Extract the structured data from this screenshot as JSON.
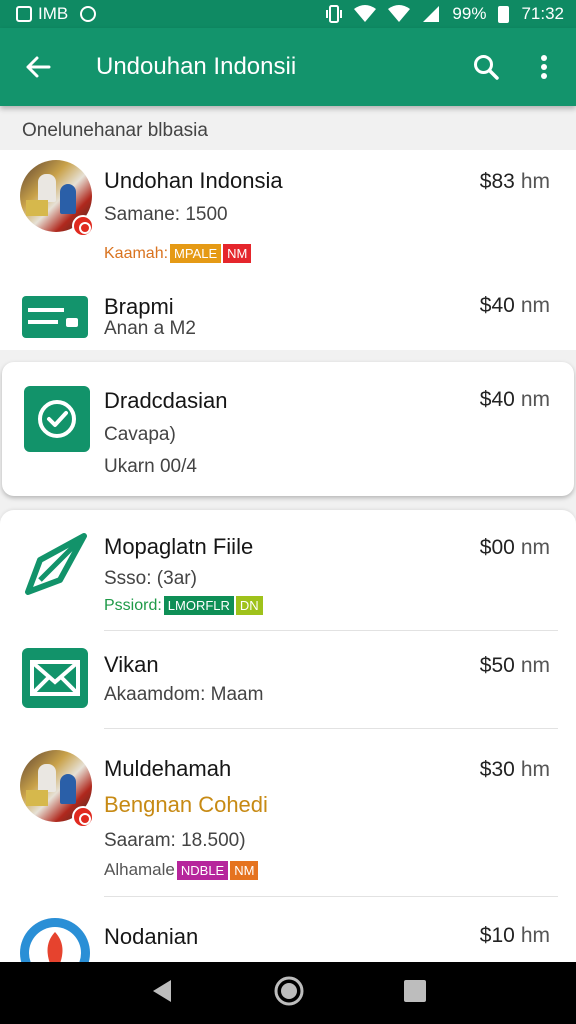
{
  "status_bar": {
    "left_text": "IMB",
    "battery": "99%",
    "time": "71:32"
  },
  "app_bar": {
    "title": "Undouhan Indonsii"
  },
  "section_header": "Onelunehanar blbasia",
  "items": [
    {
      "title": "Undohan Indonsia",
      "subtitle": "Samane: 1500",
      "price": "$83",
      "unit": "hm",
      "tag_label": "Kaamah:",
      "tags": [
        {
          "text": "MPALE",
          "color": "#e59a15"
        },
        {
          "text": "NM",
          "color": "#e5262c"
        }
      ]
    },
    {
      "title": "Brapmi",
      "subtitle": "Anan a M2",
      "price": "$40",
      "unit": "nm"
    },
    {
      "title": "Dradcdasian",
      "subtitle": "Cavapa)",
      "extra": "Ukarn 00/4",
      "price": "$40",
      "unit": "nm"
    },
    {
      "title": "Mopaglatn Fiile",
      "subtitle": "Ssso: (3ar)",
      "price": "$00",
      "unit": "nm",
      "tag_label": "Pssiord:",
      "tags": [
        {
          "text": "LMORFLR",
          "color": "#0e8f56"
        },
        {
          "text": "DN",
          "color": "#9fc21b"
        }
      ]
    },
    {
      "title": "Vikan",
      "subtitle": "Akaamdom: Maam",
      "price": "$50",
      "unit": "nm"
    },
    {
      "title": "Muldehamah",
      "subtitle": "Bengnan Cohedi",
      "extra": "Saaram: 18.500)",
      "price": "$30",
      "unit": "hm",
      "tag_label": "Alhamale",
      "tags": [
        {
          "text": "NDBLE",
          "color": "#b6259c"
        },
        {
          "text": "NM",
          "color": "#e5731f"
        }
      ]
    },
    {
      "title": "Nodanian",
      "subtitle": "",
      "price": "$10",
      "unit": "hm"
    }
  ],
  "colors": {
    "primary": "#13946c",
    "status_bar": "#0f8a63",
    "accent_text": "#c78a14",
    "orange_tag_label": "#d9731f",
    "green_tag_label": "#1f9a48"
  }
}
